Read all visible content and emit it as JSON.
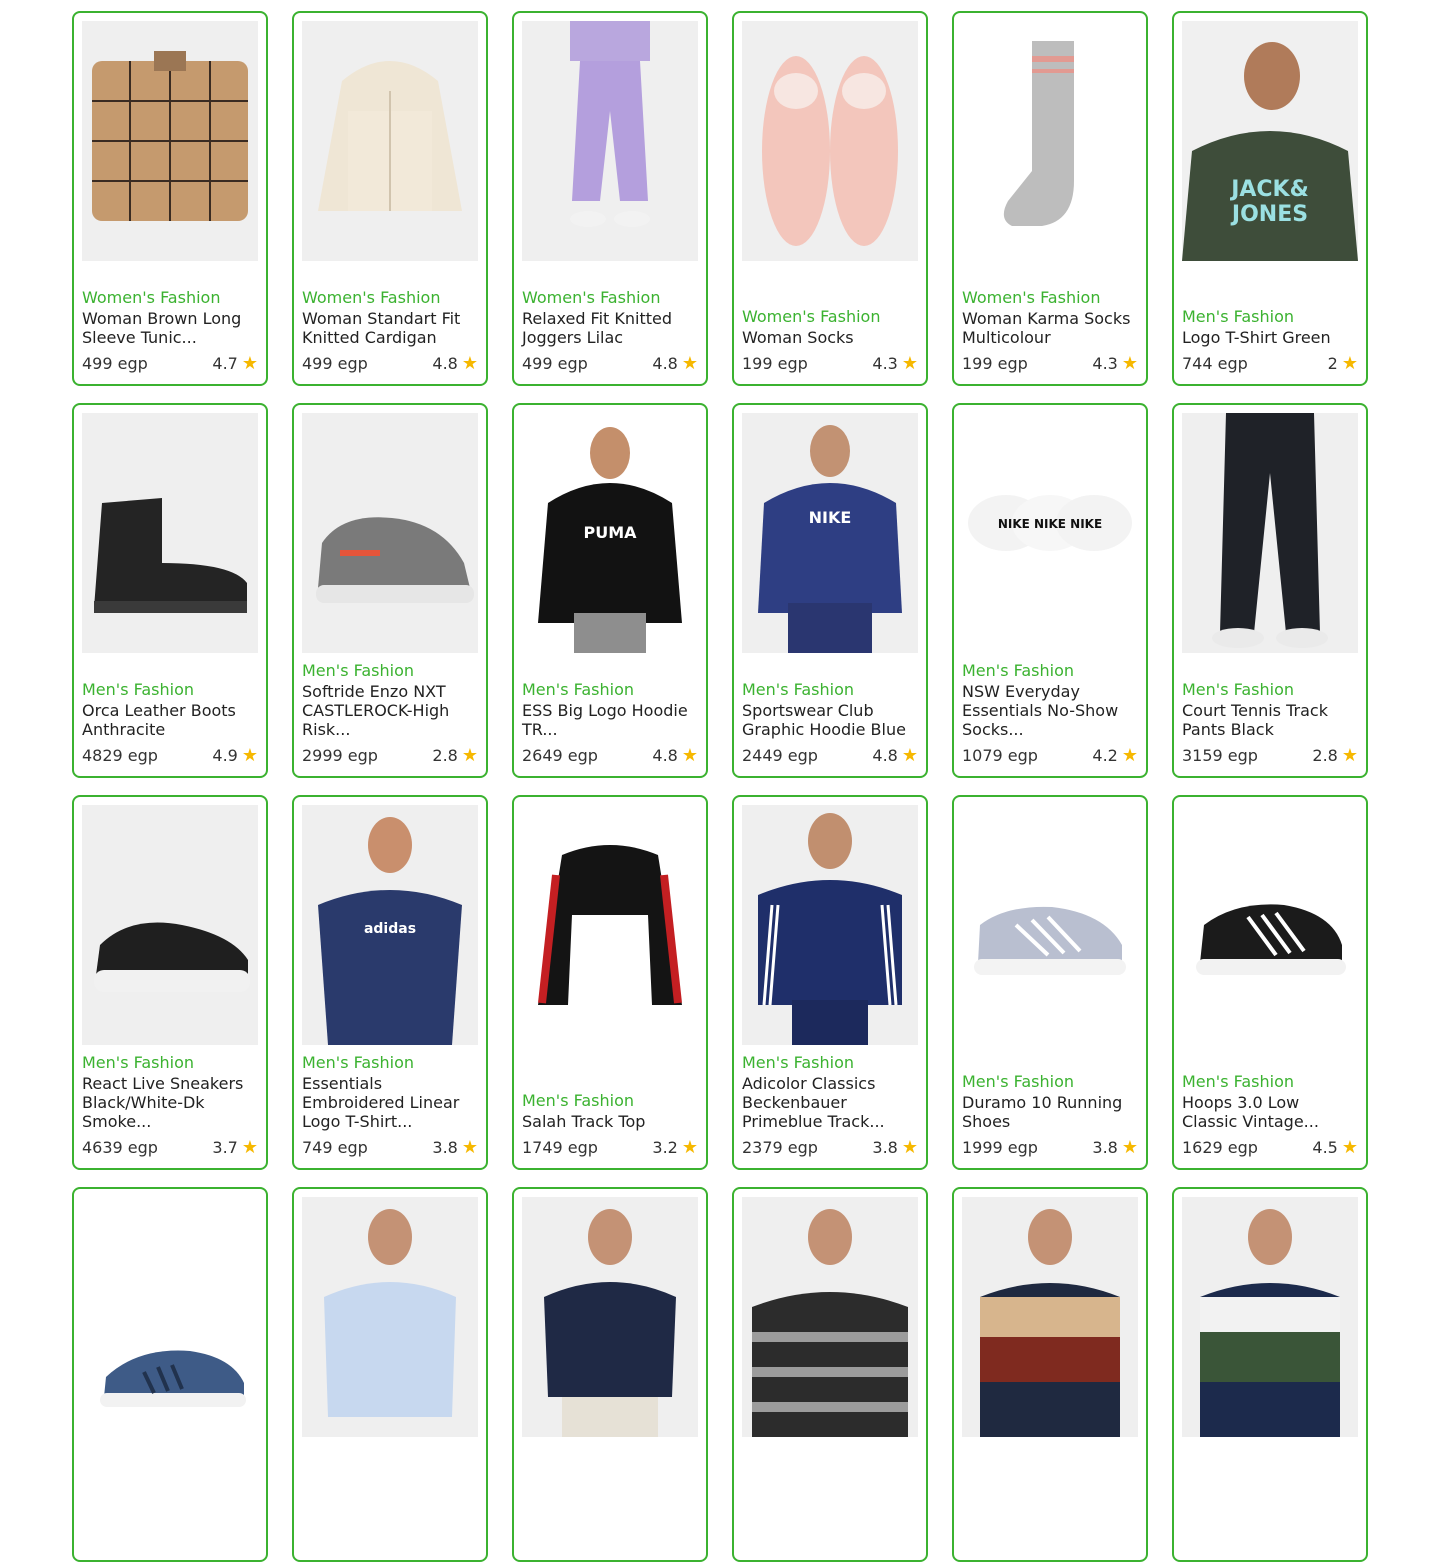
{
  "products": [
    {
      "category": "Women's Fashion",
      "title": "Woman Brown Long Sleeve Tunic...",
      "price": "499 egp",
      "rating": "4.7",
      "image": "plaid-shirt",
      "bg": "gray"
    },
    {
      "category": "Women's Fashion",
      "title": "Woman Standart Fit Knitted Cardigan",
      "price": "499 egp",
      "rating": "4.8",
      "image": "cream-hoodie",
      "bg": "gray"
    },
    {
      "category": "Women's Fashion",
      "title": "Relaxed Fit Knitted Joggers Lilac",
      "price": "499 egp",
      "rating": "4.8",
      "image": "lilac-joggers",
      "bg": "gray"
    },
    {
      "category": "Women's Fashion",
      "title": "Woman Socks",
      "price": "199 egp",
      "rating": "4.3",
      "image": "fuzzy-slippers",
      "bg": "gray"
    },
    {
      "category": "Women's Fashion",
      "title": "Woman Karma Socks Multicolour",
      "price": "199 egp",
      "rating": "4.3",
      "image": "gray-sock",
      "bg": "white"
    },
    {
      "category": "Men's Fashion",
      "title": "Logo T-Shirt Green",
      "price": "744 egp",
      "rating": "2",
      "image": "green-tshirt-model",
      "bg": "gray"
    },
    {
      "category": "Men's Fashion",
      "title": "Orca Leather Boots Anthracite",
      "price": "4829 egp",
      "rating": "4.9",
      "image": "black-boot",
      "bg": "gray"
    },
    {
      "category": "Men's Fashion",
      "title": "Softride Enzo NXT CASTLEROCK-High Risk...",
      "price": "2999 egp",
      "rating": "2.8",
      "image": "gray-sneaker",
      "bg": "gray"
    },
    {
      "category": "Men's Fashion",
      "title": "ESS Big Logo Hoodie TR...",
      "price": "2649 egp",
      "rating": "4.8",
      "image": "black-hoodie-model",
      "bg": "white"
    },
    {
      "category": "Men's Fashion",
      "title": "Sportswear Club Graphic Hoodie Blue",
      "price": "2449 egp",
      "rating": "4.8",
      "image": "blue-hoodie-model",
      "bg": "gray"
    },
    {
      "category": "Men's Fashion",
      "title": "NSW Everyday Essentials No-Show Socks...",
      "price": "1079 egp",
      "rating": "4.2",
      "image": "white-socks",
      "bg": "white"
    },
    {
      "category": "Men's Fashion",
      "title": "Court Tennis Track Pants Black",
      "price": "3159 egp",
      "rating": "2.8",
      "image": "black-track-pants",
      "bg": "gray"
    },
    {
      "category": "Men's Fashion",
      "title": "React Live Sneakers Black/White-Dk Smoke...",
      "price": "4639 egp",
      "rating": "3.7",
      "image": "black-runner",
      "bg": "gray"
    },
    {
      "category": "Men's Fashion",
      "title": "Essentials Embroidered Linear Logo T-Shirt...",
      "price": "749 egp",
      "rating": "3.8",
      "image": "navy-tshirt-model",
      "bg": "gray"
    },
    {
      "category": "Men's Fashion",
      "title": "Salah Track Top",
      "price": "1749 egp",
      "rating": "3.2",
      "image": "track-jacket",
      "bg": "white"
    },
    {
      "category": "Men's Fashion",
      "title": "Adicolor Classics Beckenbauer Primeblue Track...",
      "price": "2379 egp",
      "rating": "3.8",
      "image": "navy-tracksuit-model",
      "bg": "gray"
    },
    {
      "category": "Men's Fashion",
      "title": "Duramo 10 Running Shoes",
      "price": "1999 egp",
      "rating": "3.8",
      "image": "gray-running-shoe",
      "bg": "white"
    },
    {
      "category": "Men's Fashion",
      "title": "Hoops 3.0 Low Classic Vintage...",
      "price": "1629 egp",
      "rating": "4.5",
      "image": "black-court-shoe",
      "bg": "white"
    },
    {
      "category": "",
      "title": "",
      "price": "",
      "rating": "",
      "image": "blue-running-shoe",
      "bg": "white"
    },
    {
      "category": "",
      "title": "",
      "price": "",
      "rating": "",
      "image": "light-blue-shirt-model",
      "bg": "gray"
    },
    {
      "category": "",
      "title": "",
      "price": "",
      "rating": "",
      "image": "navy-sweater-model",
      "bg": "gray"
    },
    {
      "category": "",
      "title": "",
      "price": "",
      "rating": "",
      "image": "striped-sweater-model",
      "bg": "gray"
    },
    {
      "category": "",
      "title": "",
      "price": "",
      "rating": "",
      "image": "colorblock-sweater-model",
      "bg": "gray"
    },
    {
      "category": "",
      "title": "",
      "price": "",
      "rating": "",
      "image": "colorblock-polo-model",
      "bg": "gray"
    }
  ]
}
